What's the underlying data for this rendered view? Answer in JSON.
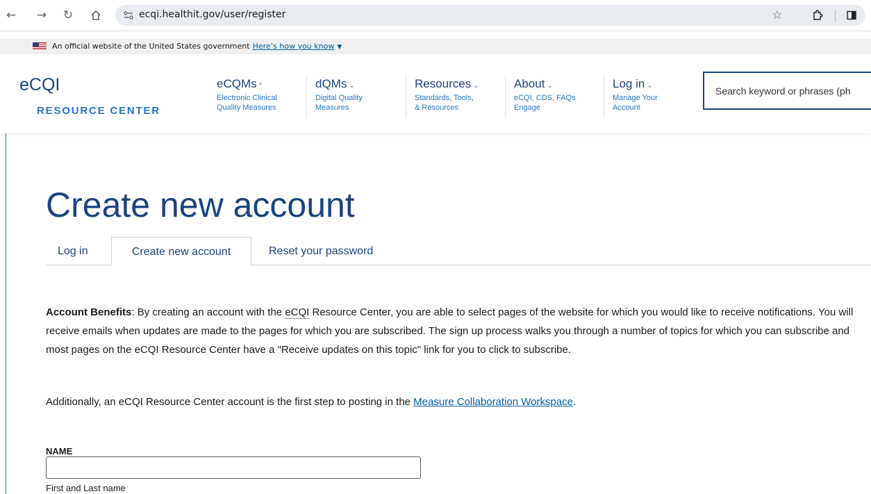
{
  "browser": {
    "url": "ecqi.healthit.gov/user/register",
    "icons": [
      "back-icon",
      "forward-icon",
      "reload-icon",
      "home-icon",
      "site-info-icon",
      "bookmark-star-icon",
      "extensions-icon",
      "side-panel-icon"
    ]
  },
  "gov_banner": {
    "text": "An official website of the United States government",
    "link": "Here’s how you know"
  },
  "logo": {
    "top": "eCQI",
    "bottom": "RESOURCE CENTER"
  },
  "nav": [
    {
      "title": "eCQMs",
      "chevron": "^",
      "sub1": "Electronic Clinical",
      "sub2": "Quality Measures"
    },
    {
      "title": "dQMs",
      "chevron": "⌄",
      "sub1": "Digital Quality",
      "sub2": "Measures"
    },
    {
      "title": "Resources",
      "chevron": "⌄",
      "sub1": "Standards, Tools,",
      "sub2": "& Resources"
    },
    {
      "title": "About",
      "chevron": "⌄",
      "sub1": "eCQI, CDS, FAQs",
      "sub2": "Engage"
    },
    {
      "title": "Log in",
      "chevron": "⌄",
      "sub1": "Manage Your",
      "sub2": "Account"
    }
  ],
  "search": {
    "placeholder": "Search keyword or phrases (ph"
  },
  "page": {
    "title": "Create new account",
    "tabs": [
      {
        "label": "Log in",
        "active": false
      },
      {
        "label": "Create new account",
        "active": true
      },
      {
        "label": "Reset your password",
        "active": false
      }
    ]
  },
  "content": {
    "benefits_heading": "Account Benefits",
    "benefits_part1": ": By creating an account with the ",
    "benefits_abbr": "eCQI",
    "benefits_part2": " Resource Center, you are able to select pages of the website for which you would like to receive notifications. You will receive emails when updates are made to the pages for which you are subscribed. The sign up process walks you through a number of topics for which you can subscribe and most pages on the eCQI Resource Center have a \"Receive updates on this topic\" link for you to click to subscribe.",
    "additional_part1": "Additionally, an eCQI Resource Center account is the first step to posting in the ",
    "additional_link": "Measure Collaboration Workspace",
    "additional_part2": "."
  },
  "form": {
    "name_label": "NAME",
    "name_value": "",
    "name_hint": "First and Last name"
  }
}
